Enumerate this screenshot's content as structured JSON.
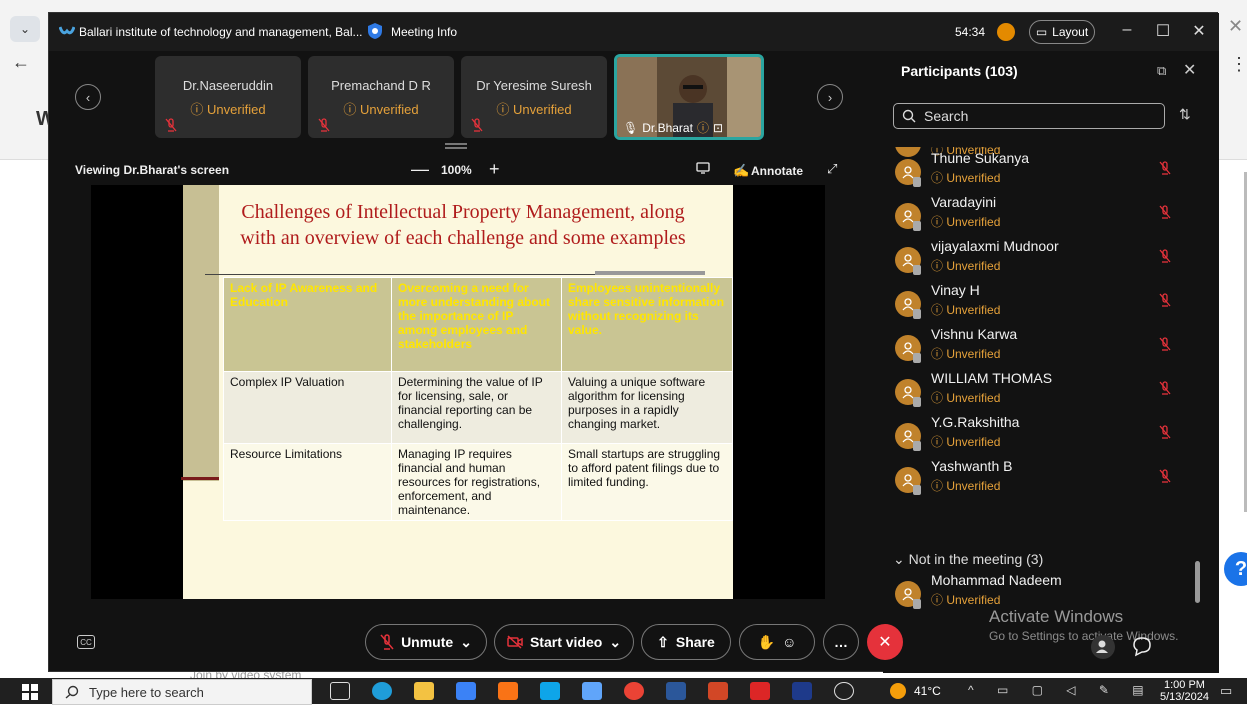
{
  "window": {
    "title": "Ballari institute of technology and management, Bal...",
    "meeting_info": "Meeting Info",
    "timer": "54:34",
    "layout": "Layout"
  },
  "tiles": [
    {
      "name": "Dr.Naseeruddin",
      "status": "Unverified"
    },
    {
      "name": "Premachand D R",
      "status": "Unverified"
    },
    {
      "name": "Dr Yeresime Suresh",
      "status": "Unverified"
    },
    {
      "name": "Dr.Bharat"
    }
  ],
  "share": {
    "viewing": "Viewing Dr.Bharat's screen",
    "zoom": "100%",
    "annotate": "Annotate"
  },
  "slide": {
    "title": "Challenges of Intellectual Property Management, along with an overview of each challenge and some examples",
    "rows": [
      [
        "Lack of IP Awareness and Education",
        "Overcoming a need for more understanding about the importance of IP among employees and stakeholders",
        "Employees unintentionally share sensitive information without recognizing its value."
      ],
      [
        "Complex IP Valuation",
        "Determining the value of IP for licensing, sale, or financial reporting can be challenging.",
        "Valuing a unique software algorithm for licensing purposes in a rapidly changing market."
      ],
      [
        "Resource Limitations",
        "Managing IP requires financial and human resources for registrations, enforcement, and maintenance.",
        "Small startups are struggling to afford patent filings due to limited funding."
      ]
    ]
  },
  "participants": {
    "title": "Participants (103)",
    "search_placeholder": "Search",
    "status": "Unverified",
    "list": [
      "Thune Sukanya",
      "Varadayini",
      "vijayalaxmi Mudnoor",
      "Vinay H",
      "Vishnu Karwa",
      "WILLIAM THOMAS",
      "Y.G.Rakshitha",
      "Yashwanth B"
    ],
    "not_in_meeting": "Not in the meeting (3)",
    "not_in_list": [
      "Mohammad Nadeem"
    ]
  },
  "toolbar": {
    "unmute": "Unmute",
    "start_video": "Start video",
    "share": "Share"
  },
  "watermark": {
    "line1": "Activate Windows",
    "line2": "Go to Settings to activate Windows."
  },
  "taskbar": {
    "search": "Type here to search",
    "temp": "41°C",
    "time": "1:00 PM",
    "date": "5/13/2024"
  },
  "colors": {
    "accent_teal": "#2aa5a0",
    "unverified": "#e5a13a",
    "leave": "#e5323b",
    "slide_title": "#b01c1c",
    "header_text": "#ffe600"
  }
}
